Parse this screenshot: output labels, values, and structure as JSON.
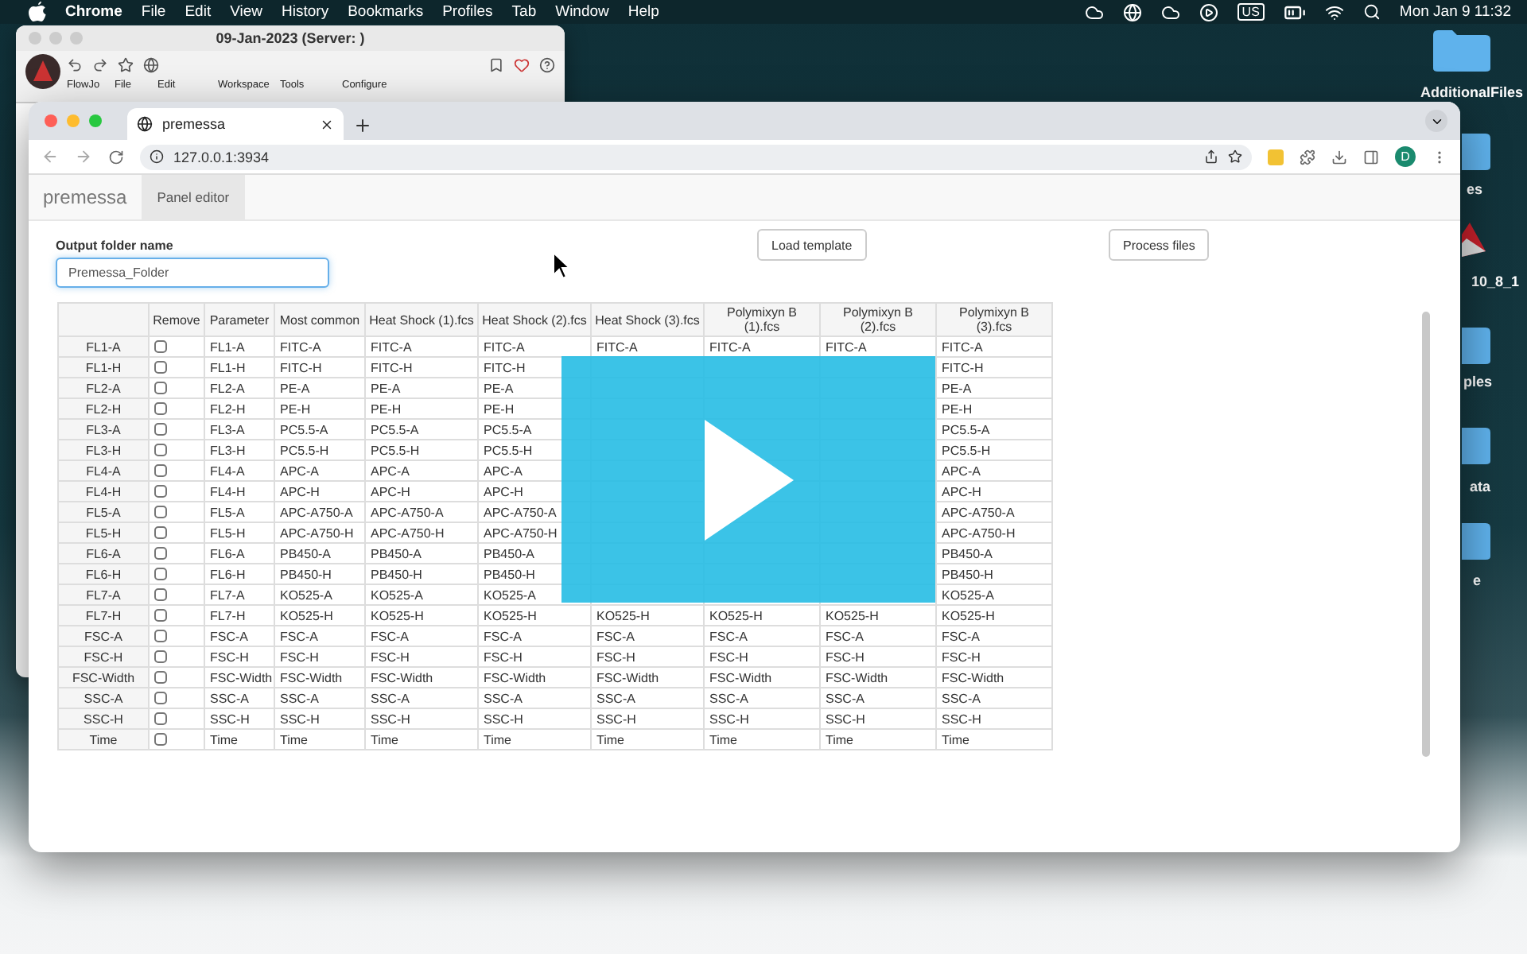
{
  "menubar": {
    "app": "Chrome",
    "menus": [
      "File",
      "Edit",
      "View",
      "History",
      "Bookmarks",
      "Profiles",
      "Tab",
      "Window",
      "Help"
    ],
    "keyboard": "US",
    "clock": "Mon Jan 9  11:32"
  },
  "desktop_icons": [
    {
      "kind": "folder",
      "label": "AdditionalFiles"
    },
    {
      "kind": "folder",
      "label": "es"
    },
    {
      "kind": "app",
      "label": "10_8_1"
    },
    {
      "kind": "folder",
      "label": "ples"
    },
    {
      "kind": "folder",
      "label": "ata"
    },
    {
      "kind": "folder",
      "label": "e"
    }
  ],
  "background_window": {
    "title": "09-Jan-2023 (Server: )",
    "menus": [
      "FlowJo",
      "File",
      "Edit",
      "Workspace",
      "Tools",
      "Configure"
    ]
  },
  "browser": {
    "tab": {
      "title": "premessa",
      "selected": true
    },
    "url": "127.0.0.1:3934",
    "profile": "D"
  },
  "app": {
    "brand": "premessa",
    "nav": [
      {
        "label": "Panel editor",
        "selected": true
      }
    ],
    "output_folder": {
      "label": "Output folder name",
      "value": "Premessa_Folder"
    },
    "buttons": [
      "Load template",
      "Process files"
    ],
    "table": {
      "remove_column": "Remove",
      "columns": [
        "Parameter",
        "Most common",
        "Heat Shock (1).fcs",
        "Heat Shock (2).fcs",
        "Heat Shock (3).fcs",
        "Polymixyn B (1).fcs",
        "Polymixyn B (2).fcs",
        "Polymixyn B (3).fcs"
      ],
      "rows": [
        {
          "name": "FL1-A",
          "remove": false,
          "cells": [
            "FL1-A",
            "FITC-A",
            "FITC-A",
            "FITC-A",
            "FITC-A",
            "FITC-A",
            "FITC-A",
            "FITC-A"
          ]
        },
        {
          "name": "FL1-H",
          "remove": false,
          "cells": [
            "FL1-H",
            "FITC-H",
            "FITC-H",
            "FITC-H",
            null,
            null,
            null,
            "FITC-H"
          ]
        },
        {
          "name": "FL2-A",
          "remove": false,
          "cells": [
            "FL2-A",
            "PE-A",
            "PE-A",
            "PE-A",
            null,
            null,
            null,
            "PE-A"
          ]
        },
        {
          "name": "FL2-H",
          "remove": false,
          "cells": [
            "FL2-H",
            "PE-H",
            "PE-H",
            "PE-H",
            null,
            null,
            null,
            "PE-H"
          ]
        },
        {
          "name": "FL3-A",
          "remove": false,
          "cells": [
            "FL3-A",
            "PC5.5-A",
            "PC5.5-A",
            "PC5.5-A",
            null,
            null,
            null,
            "PC5.5-A"
          ]
        },
        {
          "name": "FL3-H",
          "remove": false,
          "cells": [
            "FL3-H",
            "PC5.5-H",
            "PC5.5-H",
            "PC5.5-H",
            null,
            null,
            null,
            "PC5.5-H"
          ]
        },
        {
          "name": "FL4-A",
          "remove": false,
          "cells": [
            "FL4-A",
            "APC-A",
            "APC-A",
            "APC-A",
            null,
            null,
            null,
            "APC-A"
          ]
        },
        {
          "name": "FL4-H",
          "remove": false,
          "cells": [
            "FL4-H",
            "APC-H",
            "APC-H",
            "APC-H",
            null,
            null,
            null,
            "APC-H"
          ]
        },
        {
          "name": "FL5-A",
          "remove": false,
          "cells": [
            "FL5-A",
            "APC-A750-A",
            "APC-A750-A",
            "APC-A750-A",
            null,
            null,
            null,
            "APC-A750-A"
          ]
        },
        {
          "name": "FL5-H",
          "remove": false,
          "cells": [
            "FL5-H",
            "APC-A750-H",
            "APC-A750-H",
            "APC-A750-H",
            null,
            null,
            null,
            "APC-A750-H"
          ]
        },
        {
          "name": "FL6-A",
          "remove": false,
          "cells": [
            "FL6-A",
            "PB450-A",
            "PB450-A",
            "PB450-A",
            null,
            null,
            null,
            "PB450-A"
          ]
        },
        {
          "name": "FL6-H",
          "remove": false,
          "cells": [
            "FL6-H",
            "PB450-H",
            "PB450-H",
            "PB450-H",
            null,
            null,
            null,
            "PB450-H"
          ]
        },
        {
          "name": "FL7-A",
          "remove": false,
          "cells": [
            "FL7-A",
            "KO525-A",
            "KO525-A",
            "KO525-A",
            null,
            null,
            null,
            "KO525-A"
          ]
        },
        {
          "name": "FL7-H",
          "remove": false,
          "cells": [
            "FL7-H",
            "KO525-H",
            "KO525-H",
            "KO525-H",
            "KO525-H",
            "KO525-H",
            "KO525-H",
            "KO525-H"
          ]
        },
        {
          "name": "FSC-A",
          "remove": false,
          "cells": [
            "FSC-A",
            "FSC-A",
            "FSC-A",
            "FSC-A",
            "FSC-A",
            "FSC-A",
            "FSC-A",
            "FSC-A"
          ]
        },
        {
          "name": "FSC-H",
          "remove": false,
          "cells": [
            "FSC-H",
            "FSC-H",
            "FSC-H",
            "FSC-H",
            "FSC-H",
            "FSC-H",
            "FSC-H",
            "FSC-H"
          ]
        },
        {
          "name": "FSC-Width",
          "remove": false,
          "cells": [
            "FSC-Width",
            "FSC-Width",
            "FSC-Width",
            "FSC-Width",
            "FSC-Width",
            "FSC-Width",
            "FSC-Width",
            "FSC-Width"
          ]
        },
        {
          "name": "SSC-A",
          "remove": false,
          "cells": [
            "SSC-A",
            "SSC-A",
            "SSC-A",
            "SSC-A",
            "SSC-A",
            "SSC-A",
            "SSC-A",
            "SSC-A"
          ]
        },
        {
          "name": "SSC-H",
          "remove": false,
          "cells": [
            "SSC-H",
            "SSC-H",
            "SSC-H",
            "SSC-H",
            "SSC-H",
            "SSC-H",
            "SSC-H",
            "SSC-H"
          ]
        },
        {
          "name": "Time",
          "remove": false,
          "cells": [
            "Time",
            "Time",
            "Time",
            "Time",
            "Time",
            "Time",
            "Time",
            "Time"
          ]
        }
      ]
    }
  }
}
